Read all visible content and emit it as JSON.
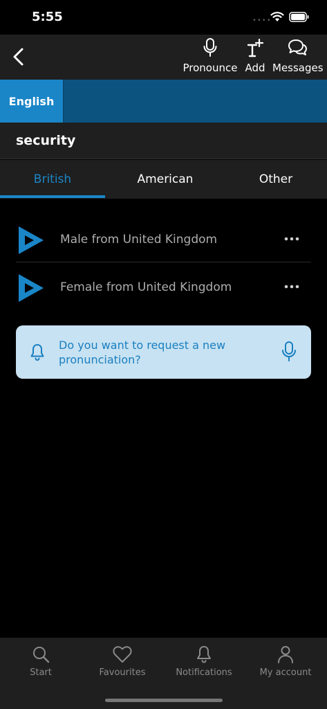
{
  "status_bar": {
    "time": "5:55",
    "signal": "••••"
  },
  "header": {
    "actions": [
      {
        "label": "Pronounce",
        "icon": "microphone-icon"
      },
      {
        "label": "Add",
        "icon": "add-text-icon"
      },
      {
        "label": "Messages",
        "icon": "chat-bubbles-icon"
      }
    ]
  },
  "language_tabs": [
    {
      "label": "English",
      "selected": true
    }
  ],
  "word": "security",
  "accent_tabs": [
    {
      "label": "British",
      "selected": true
    },
    {
      "label": "American",
      "selected": false
    },
    {
      "label": "Other",
      "selected": false
    }
  ],
  "pronunciations": [
    {
      "label": "Male from United Kingdom"
    },
    {
      "label": "Female from United Kingdom"
    }
  ],
  "request_prompt": "Do you want to request a new pronunciation?",
  "bottom_nav": [
    {
      "label": "Start",
      "icon": "search-icon"
    },
    {
      "label": "Favourites",
      "icon": "heart-icon"
    },
    {
      "label": "Notifications",
      "icon": "bell-icon"
    },
    {
      "label": "My account",
      "icon": "person-icon"
    }
  ],
  "colors": {
    "accent": "#1a86c8",
    "language_bar": "#0d5380",
    "card": "#c7e2f2",
    "surface": "#1f1f1f"
  }
}
